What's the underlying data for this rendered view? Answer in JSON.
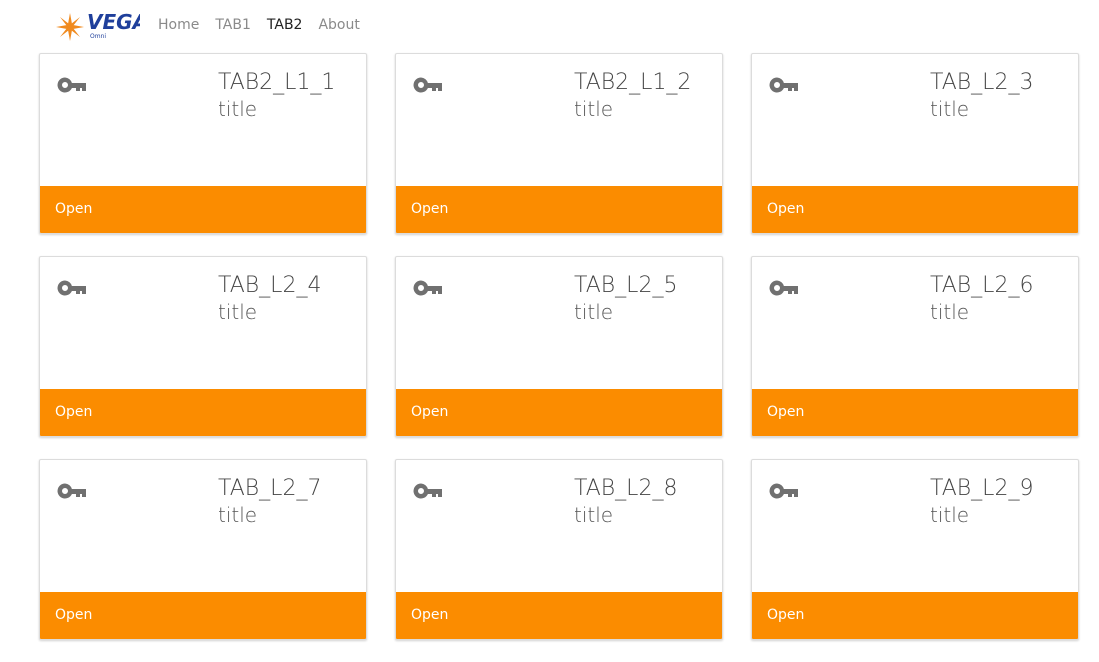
{
  "navbar": {
    "logo": {
      "text": "VEGA",
      "subtext": "Omni",
      "icon": "star-burst-icon",
      "colors": {
        "star": "#f08a1e",
        "text": "#1f3f9b"
      }
    },
    "links": [
      {
        "label": "Home",
        "active": false
      },
      {
        "label": "TAB1",
        "active": false
      },
      {
        "label": "TAB2",
        "active": true
      },
      {
        "label": "About",
        "active": false
      }
    ]
  },
  "cards": [
    {
      "title": "TAB2_L1_1",
      "subtitle": "title",
      "action": "Open",
      "icon": "key-icon"
    },
    {
      "title": "TAB2_L1_2",
      "subtitle": "title",
      "action": "Open",
      "icon": "key-icon"
    },
    {
      "title": "TAB_L2_3",
      "subtitle": "title",
      "action": "Open",
      "icon": "key-icon"
    },
    {
      "title": "TAB_L2_4",
      "subtitle": "title",
      "action": "Open",
      "icon": "key-icon"
    },
    {
      "title": "TAB_L2_5",
      "subtitle": "title",
      "action": "Open",
      "icon": "key-icon"
    },
    {
      "title": "TAB_L2_6",
      "subtitle": "title",
      "action": "Open",
      "icon": "key-icon"
    },
    {
      "title": "TAB_L2_7",
      "subtitle": "title",
      "action": "Open",
      "icon": "key-icon"
    },
    {
      "title": "TAB_L2_8",
      "subtitle": "title",
      "action": "Open",
      "icon": "key-icon"
    },
    {
      "title": "TAB_L2_9",
      "subtitle": "title",
      "action": "Open",
      "icon": "key-icon"
    }
  ],
  "colors": {
    "accent": "#fb8c00",
    "icon": "#707070",
    "nav_text": "#8a8a8a",
    "nav_active": "#222222"
  }
}
